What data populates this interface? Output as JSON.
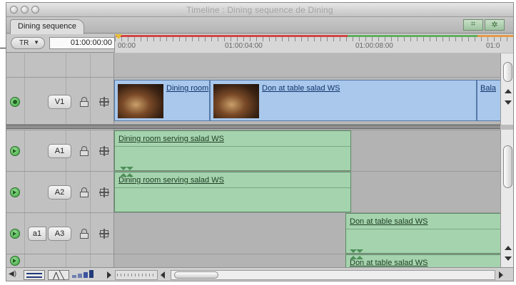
{
  "window": {
    "title": "Timeline : Dining sequence de Dining",
    "tab_label": "Dining sequence"
  },
  "toolbar": {
    "track_select": "TR",
    "timecode": "01:00:00:00"
  },
  "ruler": {
    "labels": [
      "00:00",
      "01:00:04:00",
      "01:00:08:00",
      "01:0"
    ]
  },
  "tracks": {
    "video": [
      {
        "label": "V1"
      }
    ],
    "audio": [
      {
        "label": "A1",
        "source": ""
      },
      {
        "label": "A2",
        "source": ""
      },
      {
        "label": "A3",
        "source": "a1"
      }
    ]
  },
  "clips": {
    "v1": [
      {
        "name": "Dining room"
      },
      {
        "name": "Don at table salad WS"
      },
      {
        "name": "Bala"
      }
    ],
    "a1": [
      {
        "name": "Dining room serving salad WS"
      }
    ],
    "a2": [
      {
        "name": "Dining room serving salad WS"
      }
    ],
    "a3": [
      {
        "name": "Don at table salad WS"
      }
    ],
    "a4": [
      {
        "name": "Don at table salad WS"
      }
    ]
  },
  "colors": {
    "video_clip": "#a9c8ec",
    "audio_clip": "#a5d3ae",
    "in_out_red": "#d04545",
    "render_green": "#5fae5f"
  }
}
